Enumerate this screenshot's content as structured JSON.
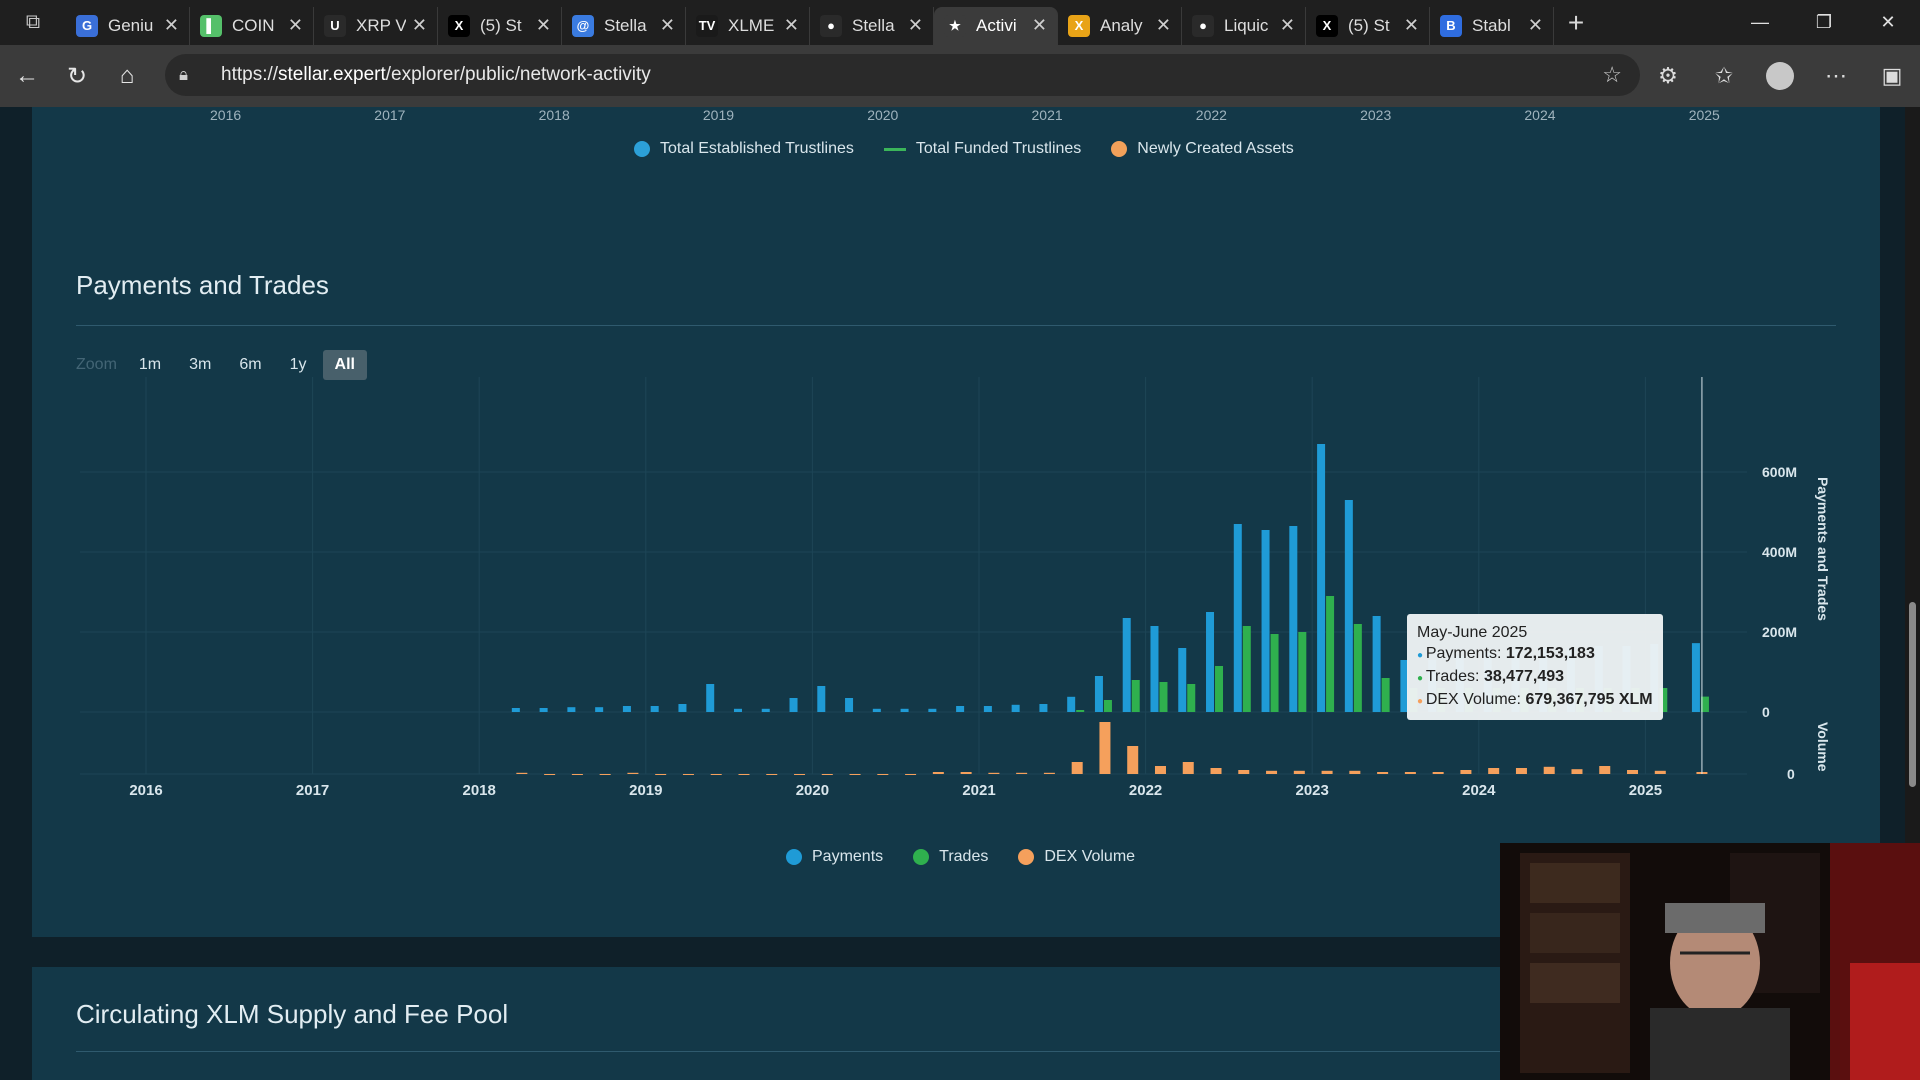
{
  "browser": {
    "tabs": [
      {
        "label": "Geniu",
        "fav": "G",
        "color": "#3a6fd8"
      },
      {
        "label": "COIN",
        "fav": "▌",
        "color": "#55c06a"
      },
      {
        "label": "XRP V",
        "fav": "U",
        "color": "#2a2a2a"
      },
      {
        "label": "(5) St",
        "fav": "X",
        "color": "#000000"
      },
      {
        "label": "Stella",
        "fav": "@",
        "color": "#3a7be0"
      },
      {
        "label": "XLME",
        "fav": "TV",
        "color": "#1a1a1a"
      },
      {
        "label": "Stella",
        "fav": "●",
        "color": "#2a2a2a"
      },
      {
        "label": "Activi",
        "fav": "★",
        "color": "#3b3b3b"
      },
      {
        "label": "Analy",
        "fav": "X",
        "color": "#e8a317"
      },
      {
        "label": "Liquic",
        "fav": "●",
        "color": "#2a2a2a"
      },
      {
        "label": "(5) St",
        "fav": "X",
        "color": "#000000"
      },
      {
        "label": "Stabl",
        "fav": "B",
        "color": "#2f6de0"
      }
    ],
    "active_tab": 7,
    "url_prefix": "https://",
    "url_host": "stellar.expert",
    "url_path": "/explorer/public/network-activity"
  },
  "top_chart": {
    "x_ticks": [
      "2016",
      "2017",
      "2018",
      "2019",
      "2020",
      "2021",
      "2022",
      "2023",
      "2024",
      "2025"
    ],
    "legend": [
      {
        "label": "Total Established Trustlines",
        "color": "#2ca0d8",
        "kind": "dot"
      },
      {
        "label": "Total Funded Trustlines",
        "color": "#3bb55a",
        "kind": "line"
      },
      {
        "label": "Newly Created Assets",
        "color": "#f2a15a",
        "kind": "dot"
      }
    ]
  },
  "payments_section": {
    "title": "Payments and Trades",
    "zoom_label": "Zoom",
    "zoom_buttons": [
      "1m",
      "3m",
      "6m",
      "1y",
      "All"
    ],
    "zoom_selected": "All"
  },
  "chart_data": {
    "type": "bar",
    "x": [
      "2018-04",
      "2018-06",
      "2018-08",
      "2018-10",
      "2018-12",
      "2019-02",
      "2019-04",
      "2019-06",
      "2019-08",
      "2019-10",
      "2019-12",
      "2020-02",
      "2020-04",
      "2020-06",
      "2020-08",
      "2020-10",
      "2020-12",
      "2021-02",
      "2021-04",
      "2021-06",
      "2021-08",
      "2021-10",
      "2021-12",
      "2022-02",
      "2022-04",
      "2022-06",
      "2022-08",
      "2022-10",
      "2022-12",
      "2023-02",
      "2023-04",
      "2023-06",
      "2023-08",
      "2023-10",
      "2023-12",
      "2024-02",
      "2024-04",
      "2024-06",
      "2024-08",
      "2024-10",
      "2024-12",
      "2025-02",
      "2025-05"
    ],
    "series": [
      {
        "name": "Payments",
        "color": "#1f9bd6",
        "axis": "Payments and Trades",
        "values": [
          10,
          10,
          12,
          12,
          15,
          15,
          20,
          70,
          8,
          8,
          35,
          65,
          35,
          8,
          8,
          8,
          15,
          15,
          18,
          20,
          38,
          90,
          235,
          215,
          160,
          250,
          470,
          455,
          465,
          670,
          530,
          240,
          130,
          130,
          140,
          150,
          155,
          160,
          160,
          165,
          165,
          170,
          172.153183
        ]
      },
      {
        "name": "Trades",
        "color": "#2fb04e",
        "axis": "Payments and Trades",
        "values": [
          0,
          0,
          0,
          0,
          0,
          0,
          0,
          0,
          0,
          0,
          0,
          0,
          0,
          0,
          0,
          0,
          0,
          0,
          0,
          0,
          5,
          30,
          80,
          75,
          70,
          115,
          215,
          195,
          200,
          290,
          220,
          85,
          60,
          60,
          60,
          60,
          60,
          60,
          60,
          60,
          60,
          60,
          38.477493
        ]
      },
      {
        "name": "DEX Volume",
        "color": "#f5a05c",
        "axis": "Volume",
        "values": [
          3,
          0,
          0,
          0,
          3,
          0,
          0,
          0,
          0,
          0,
          0,
          0,
          0,
          0,
          0,
          5,
          5,
          3,
          3,
          3,
          30,
          130,
          70,
          20,
          30,
          15,
          10,
          8,
          8,
          8,
          8,
          5,
          5,
          5,
          10,
          15,
          15,
          18,
          12,
          20,
          10,
          8,
          5
        ]
      }
    ],
    "y_axis_right": {
      "label": "Payments and Trades",
      "ticks": [
        "600M",
        "400M",
        "200M",
        "0"
      ],
      "ylim": [
        0,
        700
      ]
    },
    "y_axis_volume": {
      "label": "Volume",
      "ticks": [
        "0"
      ]
    },
    "x_ticks": [
      "2016",
      "2017",
      "2018",
      "2019",
      "2020",
      "2021",
      "2022",
      "2023",
      "2024",
      "2025"
    ],
    "legend": [
      {
        "label": "Payments",
        "color": "#1f9bd6"
      },
      {
        "label": "Trades",
        "color": "#2fb04e"
      },
      {
        "label": "DEX Volume",
        "color": "#f5a05c"
      }
    ],
    "tooltip": {
      "title": "May-June 2025",
      "rows": [
        {
          "label": "Payments:",
          "value": "172,153,183",
          "color": "#1f9bd6"
        },
        {
          "label": "Trades:",
          "value": "38,477,493",
          "color": "#2fb04e"
        },
        {
          "label": "DEX Volume:",
          "value": "679,367,795 XLM",
          "color": "#f5a05c"
        }
      ]
    }
  },
  "next_section": {
    "title": "Circulating XLM Supply and Fee Pool"
  }
}
